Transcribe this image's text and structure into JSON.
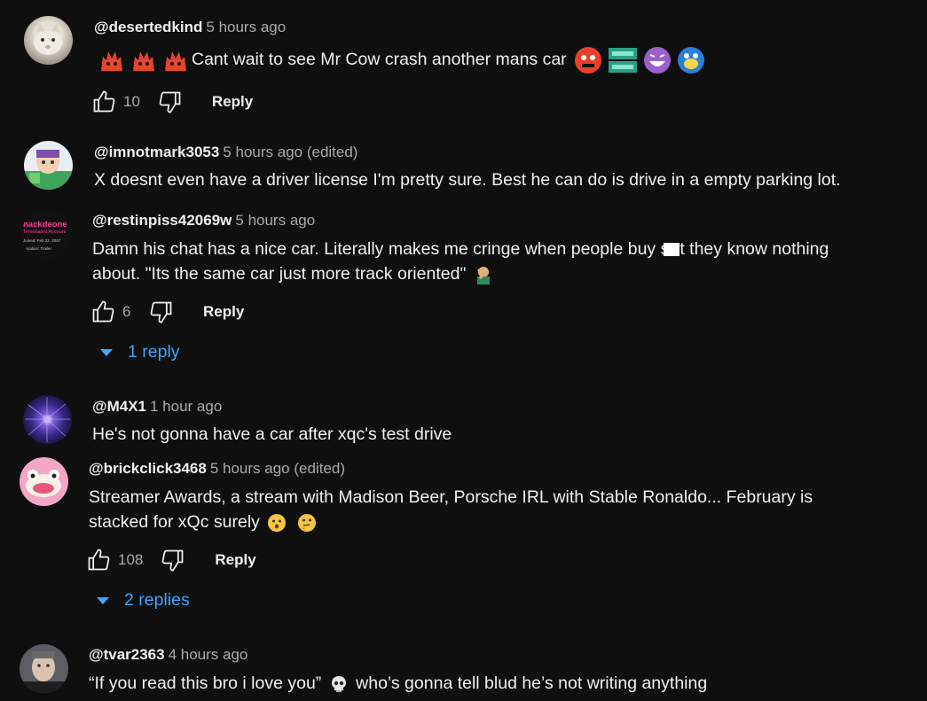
{
  "comments": [
    {
      "handle": "@desertedkind",
      "time": "5 hours ago",
      "text": "Cant wait to see Mr Cow crash another mans car",
      "likes": "10",
      "reply_label": "Reply",
      "avatar_colors": [
        "#d8d2c8",
        "#8c8479"
      ]
    },
    {
      "handle": "@imnotmark3053",
      "time": "5 hours ago (edited)",
      "text": "X doesnt even have a driver license I'm pretty  sure. Best he can do is drive in a empty parking lot."
    },
    {
      "handle": "@restinpiss42069w",
      "time": "5 hours ago",
      "text_line1_a": "Damn his chat has a nice car. Literally makes me cringe when people buy s",
      "text_line1_b": "t they know nothing",
      "text_line2": "about. \"Its the same car just more track oriented\"",
      "likes": "6",
      "reply_label": "Reply",
      "replies_label": "1 reply",
      "avatar_text": [
        "hackdeone",
        "Terminated Account",
        "Joined: Feb 22, 2007",
        "Location: Trailer"
      ]
    },
    {
      "handle": "@M4X1",
      "time": "1 hour ago",
      "text": "He's not gonna have a car after xqc's test drive"
    },
    {
      "handle": "@brickclick3468",
      "time": "5 hours ago (edited)",
      "text_line1": "Streamer Awards, a stream with Madison Beer, Porsche IRL with Stable Ronaldo... February is",
      "text_line2": "stacked for xQc surely",
      "likes": "108",
      "reply_label": "Reply",
      "replies_label": "2 replies"
    },
    {
      "handle": "@tvar2363",
      "time": "4 hours ago",
      "text_a": "“If you read this bro i love you”",
      "text_b": "who’s gonna tell blud he’s not writing anything"
    }
  ],
  "colors": {
    "background": "#0f0f0f",
    "text": "#f1f1f1",
    "secondary": "#aaaaaa",
    "link": "#3ea6ff"
  },
  "icons": [
    "like-icon",
    "dislike-icon",
    "caret-down-icon",
    "emoji-icon",
    "skull-icon"
  ]
}
